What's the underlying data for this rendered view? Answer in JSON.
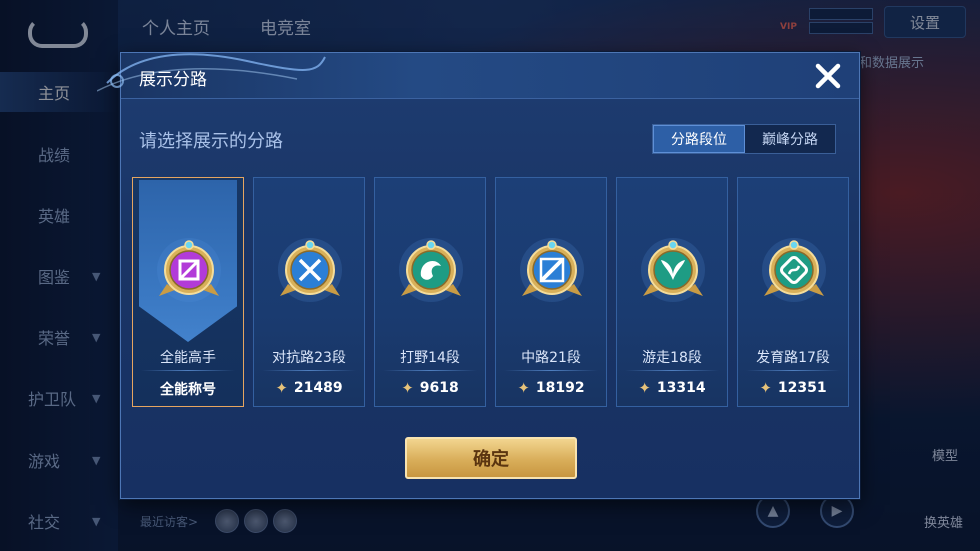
{
  "background_app": {
    "sidebar_items": [
      {
        "label": "主页",
        "has_chevron": false,
        "active": true
      },
      {
        "label": "战绩",
        "has_chevron": false,
        "active": false
      },
      {
        "label": "英雄",
        "has_chevron": false,
        "active": false
      },
      {
        "label": "图鉴",
        "has_chevron": true,
        "active": false
      },
      {
        "label": "荣誉",
        "has_chevron": true,
        "active": false
      },
      {
        "label": "护卫队",
        "has_chevron": true,
        "active": false
      },
      {
        "label": "游戏",
        "has_chevron": true,
        "active": false
      },
      {
        "label": "社交",
        "has_chevron": true,
        "active": false
      }
    ],
    "top_tabs": [
      "个人主页",
      "电竞室"
    ],
    "settings_label": "设置",
    "vip_badge": "VIP",
    "data_display_label": "主和数据展示",
    "recent_visitors_label": "最近访客>",
    "right_labels": [
      "模型",
      "换英雄"
    ]
  },
  "modal": {
    "title": "展示分路",
    "subtitle": "请选择展示的分路",
    "segmented": {
      "options": [
        "分路段位",
        "巅峰分路"
      ],
      "selected_index": 0
    },
    "cards": [
      {
        "label": "全能高手",
        "value": "全能称号",
        "has_star": false,
        "selected": true,
        "icon": "all-round-emblem-icon",
        "color": "#b23bd8"
      },
      {
        "label": "对抗路23段",
        "value": "21489",
        "has_star": true,
        "selected": false,
        "icon": "clash-lane-emblem-icon",
        "color": "#2b7fd6"
      },
      {
        "label": "打野14段",
        "value": "9618",
        "has_star": true,
        "selected": false,
        "icon": "jungle-dragon-emblem-icon",
        "color": "#1e9c84"
      },
      {
        "label": "中路21段",
        "value": "18192",
        "has_star": true,
        "selected": false,
        "icon": "mid-lane-emblem-icon",
        "color": "#2b7fd6"
      },
      {
        "label": "游走18段",
        "value": "13314",
        "has_star": true,
        "selected": false,
        "icon": "roam-wings-emblem-icon",
        "color": "#1e9c84"
      },
      {
        "label": "发育路17段",
        "value": "12351",
        "has_star": true,
        "selected": false,
        "icon": "farm-lane-emblem-icon",
        "color": "#1e9c84"
      }
    ],
    "confirm_label": "确定"
  }
}
